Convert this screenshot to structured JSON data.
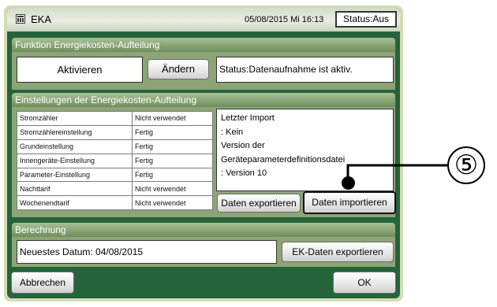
{
  "window": {
    "title": "EKA",
    "datetime": "05/08/2015 Mi 16:13",
    "status": "Status:Aus"
  },
  "funktion": {
    "header": "Funktion Energiekosten-Aufteilung",
    "value": "Aktivieren",
    "change_label": "Ändern",
    "status_text": "Status:Datenaufnahme ist aktiv."
  },
  "einstellungen": {
    "header": "Einstellungen der Energiekosten-Aufteilung",
    "rows": [
      {
        "name": "Stromzähler",
        "status": "Nicht verwendet"
      },
      {
        "name": "Stromzählereinstellung",
        "status": "Fertig"
      },
      {
        "name": "Grundeinstellung",
        "status": "Fertig"
      },
      {
        "name": "Innengeräte-Einstellung",
        "status": "Fertig"
      },
      {
        "name": "Parameter-Einstellung",
        "status": "Fertig"
      },
      {
        "name": "Nachttarif",
        "status": "Nicht verwendet"
      },
      {
        "name": "Wochenendtarif",
        "status": "Nicht verwendet"
      }
    ],
    "import_info": [
      "Letzter Import",
      ": Kein",
      "Version der",
      "Geräteparameterdefinitionsdatei",
      ": Version 10"
    ],
    "export_label": "Daten exportieren",
    "import_label": "Daten importieren"
  },
  "berechnung": {
    "header": "Berechnung",
    "latest_date": "Neuestes Datum: 04/08/2015",
    "export_label": "EK-Daten exportieren"
  },
  "footer": {
    "cancel_label": "Abbrechen",
    "ok_label": "OK"
  },
  "callout": {
    "number": "⑤"
  },
  "colors": {
    "screen_bg": "#25643a",
    "section_body": "#8ca476",
    "frame": "#d5dbb4"
  }
}
